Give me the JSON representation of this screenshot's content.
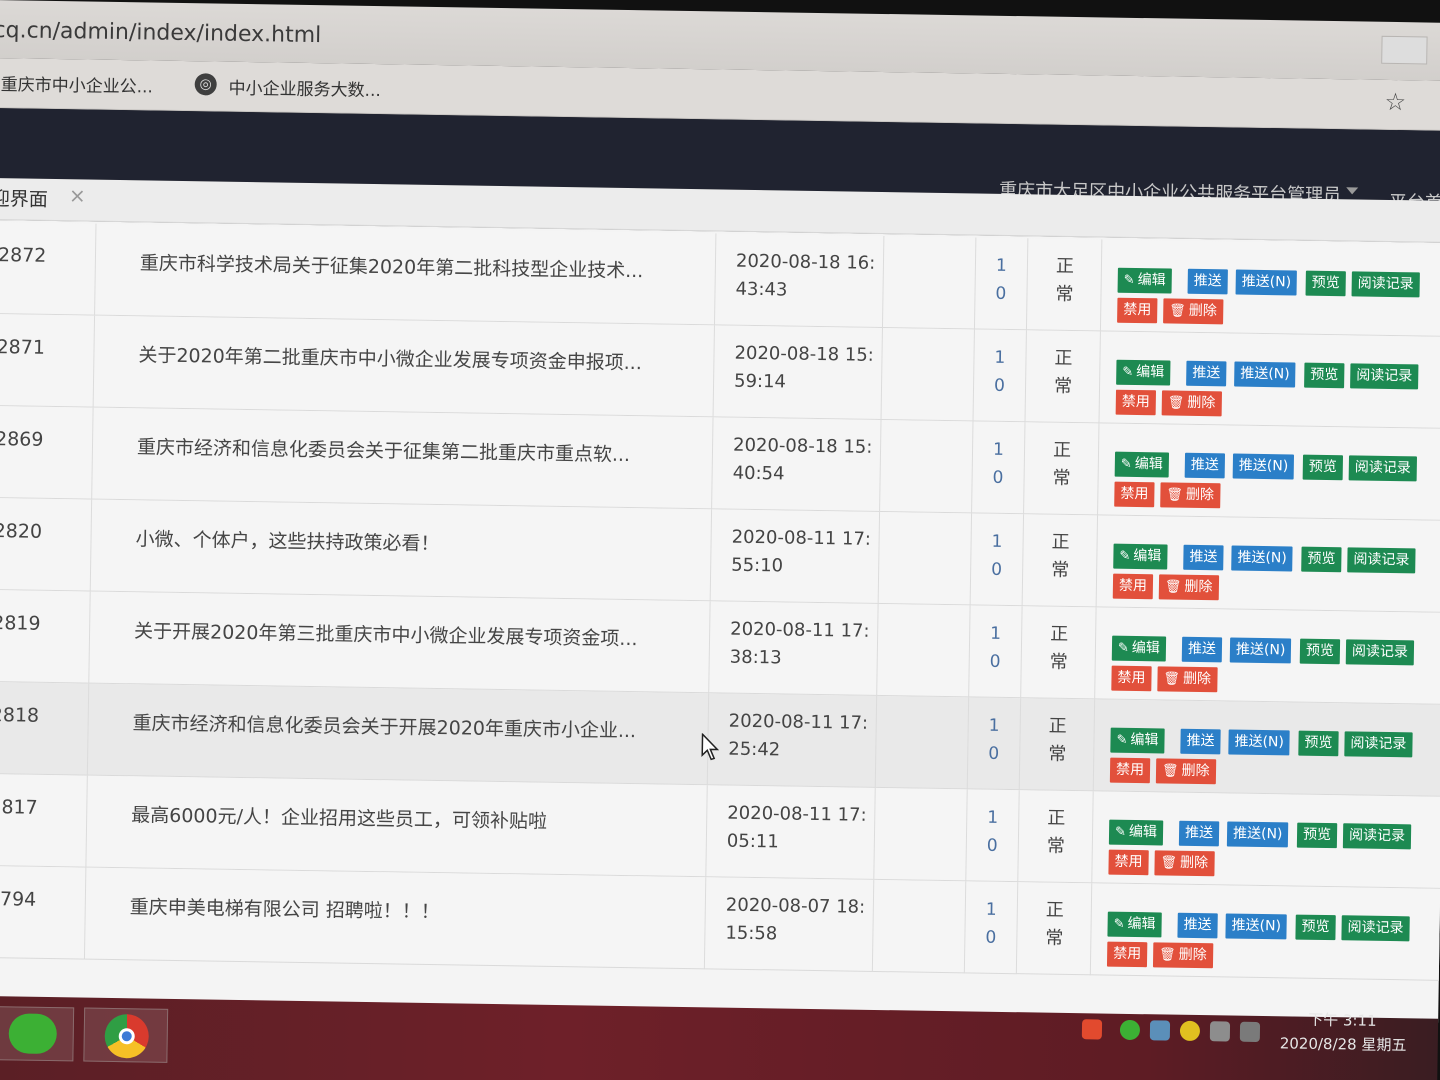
{
  "browser": {
    "url": "cq.cn/admin/index/index.html",
    "bookmarks": [
      {
        "label": "重庆市中小企业公..."
      },
      {
        "label": "中小企业服务大数..."
      }
    ]
  },
  "header": {
    "admin_name": "重庆市大足区中小企业公共服务平台管理员",
    "extra_label": "平台首"
  },
  "tab": {
    "label": "迎界面",
    "close": "×"
  },
  "buttons": {
    "edit": "编辑",
    "push": "推送",
    "push_n": "推送(N)",
    "preview": "预览",
    "read_log": "阅读记录",
    "disable": "禁用",
    "delete": "删除"
  },
  "rows": [
    {
      "id": "2872",
      "title": "重庆市科学技术局关于征集2020年第二批科技型企业技术...",
      "time_line1": "2020-08-18 16:",
      "time_line2": "43:43",
      "count_line1": "1",
      "count_line2": "0",
      "status_line1": "正",
      "status_line2": "常"
    },
    {
      "id": "2871",
      "title": "关于2020年第二批重庆市中小微企业发展专项资金申报项...",
      "time_line1": "2020-08-18 15:",
      "time_line2": "59:14",
      "count_line1": "1",
      "count_line2": "0",
      "status_line1": "正",
      "status_line2": "常"
    },
    {
      "id": "2869",
      "title": "重庆市经济和信息化委员会关于征集第二批重庆市重点软...",
      "time_line1": "2020-08-18 15:",
      "time_line2": "40:54",
      "count_line1": "1",
      "count_line2": "0",
      "status_line1": "正",
      "status_line2": "常"
    },
    {
      "id": "2820",
      "title": "小微、个体户，这些扶持政策必看！",
      "time_line1": "2020-08-11 17:",
      "time_line2": "55:10",
      "count_line1": "1",
      "count_line2": "0",
      "status_line1": "正",
      "status_line2": "常"
    },
    {
      "id": "2819",
      "title": "关于开展2020年第三批重庆市中小微企业发展专项资金项...",
      "time_line1": "2020-08-11 17:",
      "time_line2": "38:13",
      "count_line1": "1",
      "count_line2": "0",
      "status_line1": "正",
      "status_line2": "常"
    },
    {
      "id": "2818",
      "title": "重庆市经济和信息化委员会关于开展2020年重庆市小企业...",
      "time_line1": "2020-08-11 17:",
      "time_line2": "25:42",
      "count_line1": "1",
      "count_line2": "0",
      "status_line1": "正",
      "status_line2": "常"
    },
    {
      "id": "2817",
      "title": "最高6000元/人！企业招用这些员工，可领补贴啦",
      "time_line1": "2020-08-11 17:",
      "time_line2": "05:11",
      "count_line1": "1",
      "count_line2": "0",
      "status_line1": "正",
      "status_line2": "常"
    },
    {
      "id": "2794",
      "title": "重庆申美电梯有限公司 招聘啦！！！",
      "time_line1": "2020-08-07 18:",
      "time_line2": "15:58",
      "count_line1": "1",
      "count_line2": "0",
      "status_line1": "正",
      "status_line2": "常"
    }
  ],
  "taskbar": {
    "time": "下午 3:11",
    "date": "2020/8/28 星期五",
    "apps": [
      "wechat-icon",
      "chrome-icon"
    ]
  },
  "colors": {
    "green_button": "#1d8a52",
    "blue_button": "#2b7fc8",
    "red_button": "#e2503b",
    "header_bg": "#202330"
  }
}
